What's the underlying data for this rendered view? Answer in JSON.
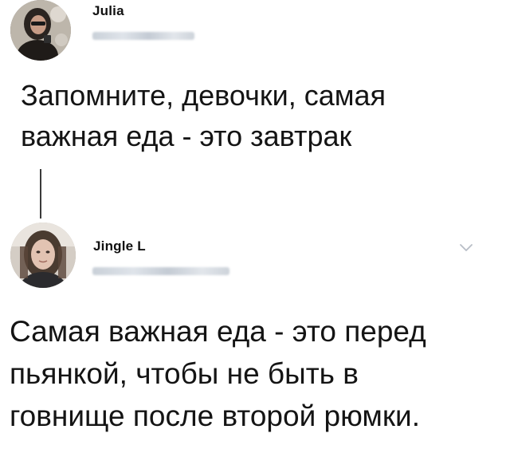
{
  "reply_chain": {
    "original": {
      "author_name": "Julia",
      "text": "Запомните, девочки, самая\nважная еда - это завтрак"
    },
    "reply": {
      "author_name": "Jingle L",
      "text": "Самая важная еда - это перед\nпьянкой, чтобы не быть в\nговнище после второй рюмки."
    }
  },
  "icons": {
    "chevron": "chevron-down-icon"
  },
  "colors": {
    "text": "#141414",
    "thread_line": "#3a3a3a",
    "chevron": "#b8bec6"
  }
}
